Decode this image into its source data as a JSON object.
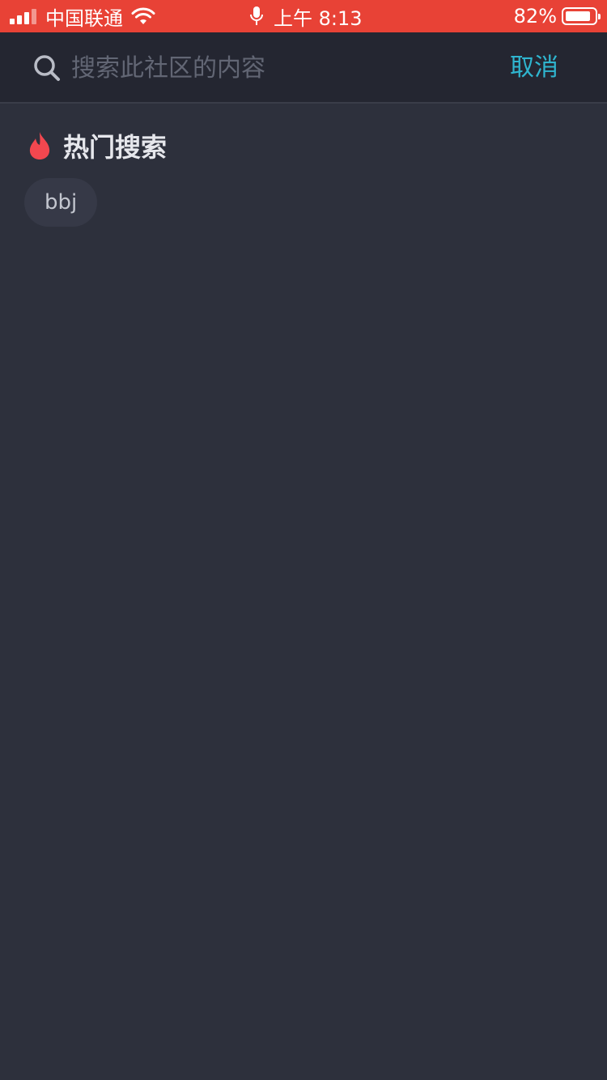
{
  "status_bar": {
    "carrier": "中国联通",
    "time": "上午 8:13",
    "battery": "82%",
    "signal_icon": "signal-icon",
    "wifi_icon": "wifi-icon",
    "mic_icon": "microphone-icon",
    "battery_level": 0.82,
    "bg_color": "#e84236"
  },
  "search": {
    "placeholder": "搜索此社区的内容",
    "value": "",
    "icon": "search-icon",
    "cancel_label": "取消",
    "accent_color": "#2fb5cf"
  },
  "hot": {
    "icon": "flame-icon",
    "title": "热门搜索",
    "tags": [
      {
        "label": "bbj"
      }
    ]
  }
}
